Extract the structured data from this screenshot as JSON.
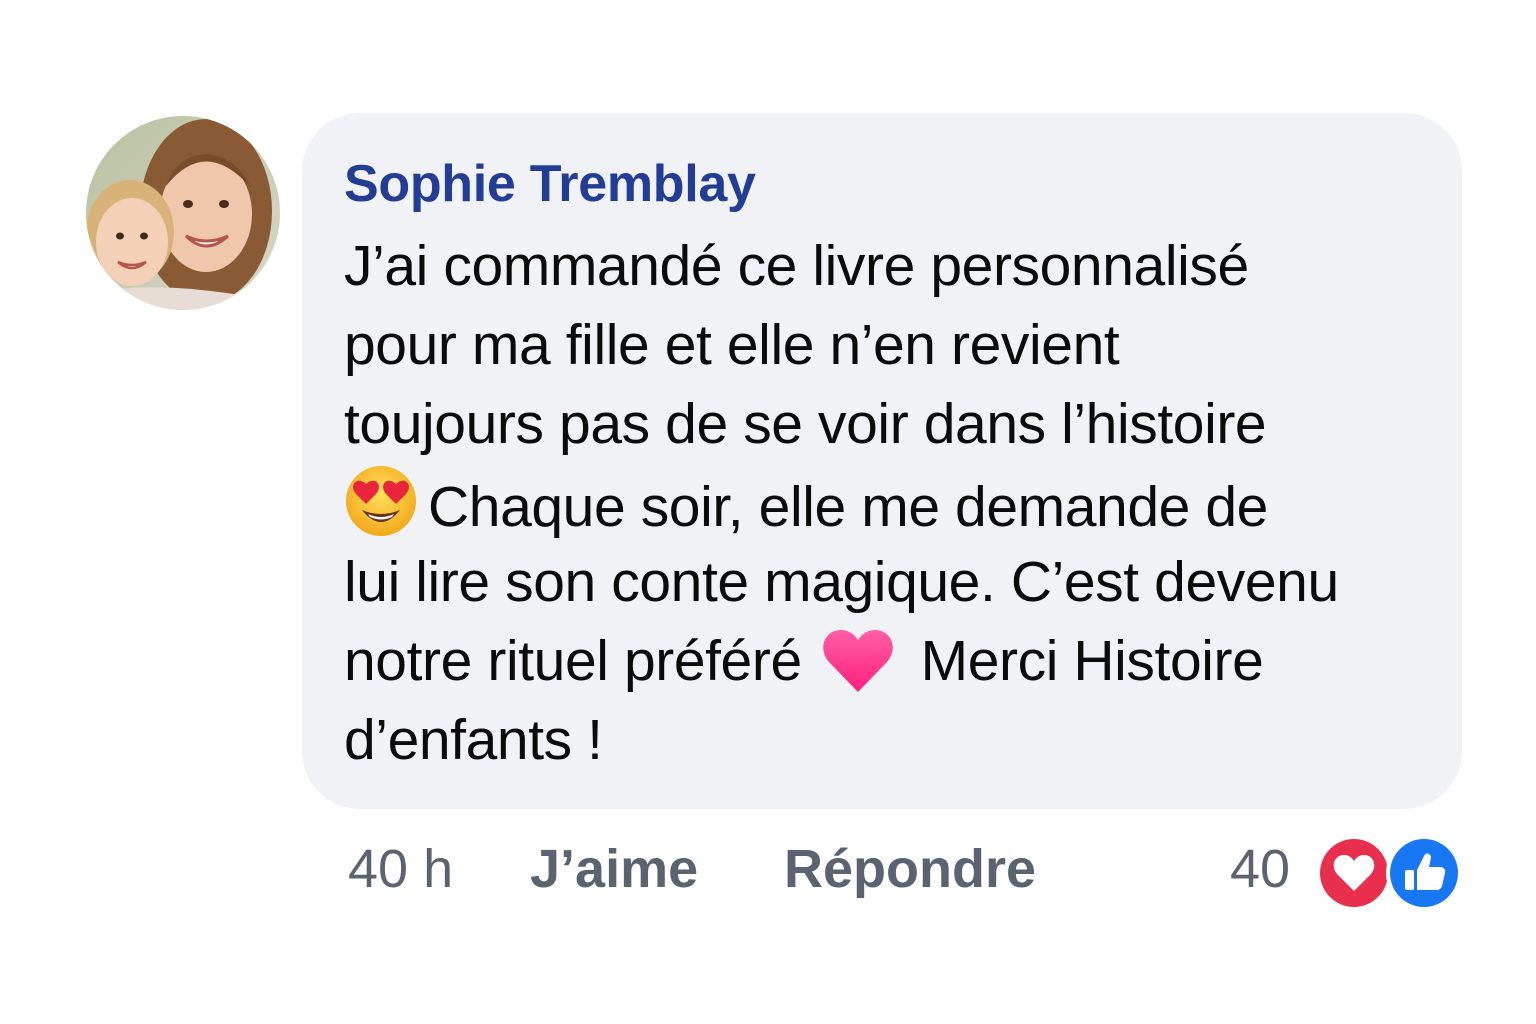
{
  "comment": {
    "author": "Sophie Tremblay",
    "avatar_icon": "profile-photo-mother-and-child",
    "text_lines": [
      "J’ai commandé ce livre personnalisé",
      "pour ma fille et elle n’en revient",
      "toujours pas de se voir dans l’histoire",
      "Chaque soir, elle me demande de",
      "lui lire son conte magique. C’est devenu",
      "notre rituel préféré",
      "Merci Histoire",
      "d’enfants !"
    ],
    "emojis": [
      "heart-eyes-emoji",
      "pink-heart-emoji"
    ]
  },
  "actions": {
    "time": "40 h",
    "like_label": "J’aime",
    "reply_label": "Répondre"
  },
  "reactions": {
    "count": "40",
    "icons": [
      "love-reaction-icon",
      "like-reaction-icon"
    ],
    "love_color": "#e8304e",
    "like_color": "#1877f2"
  },
  "colors": {
    "author": "#233c94",
    "bubble_bg": "#f1f2f6",
    "meta_text": "#5c6370"
  }
}
